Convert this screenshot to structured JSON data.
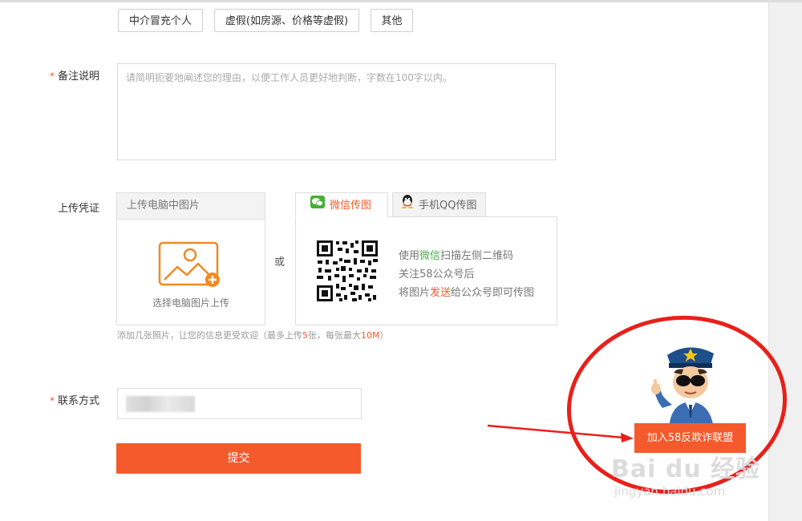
{
  "reasons": [
    "中介冒充个人",
    "虚假(如房源、价格等虚假)",
    "其他"
  ],
  "remark": {
    "required_mark": "*",
    "label": "备注说明",
    "placeholder": "请简明扼要地阐述您的理由，以便工作人员更好地判断，字数在100字以内。"
  },
  "upload": {
    "label": "上传凭证",
    "pc_tab": "上传电脑中图片",
    "pc_caption": "选择电脑图片上传",
    "or": "或",
    "wechat_tab": "微信传图",
    "qq_tab": "手机QQ传图",
    "line1_a": "使用",
    "line1_b": "微信",
    "line1_c": "扫描左侧二维码",
    "line2": "关注58公众号后",
    "line3_a": "将图片",
    "line3_b": "发送",
    "line3_c": "给公众号即可传图",
    "hint_a": "添加几张照片，让您的信息更受欢迎（最多上传",
    "hint_b": "5",
    "hint_c": "张，每张最大",
    "hint_d": "10M",
    "hint_e": "）"
  },
  "contact": {
    "required_mark": "*",
    "label": "联系方式"
  },
  "submit_label": "提交",
  "join_label": "加入58反欺诈联盟",
  "watermark": {
    "main": "Bai du 经验",
    "url": "jingyan.baidu.com"
  },
  "colors": {
    "accent": "#f55a2c",
    "annotation": "#e8201a",
    "wechat": "#4caf50"
  }
}
